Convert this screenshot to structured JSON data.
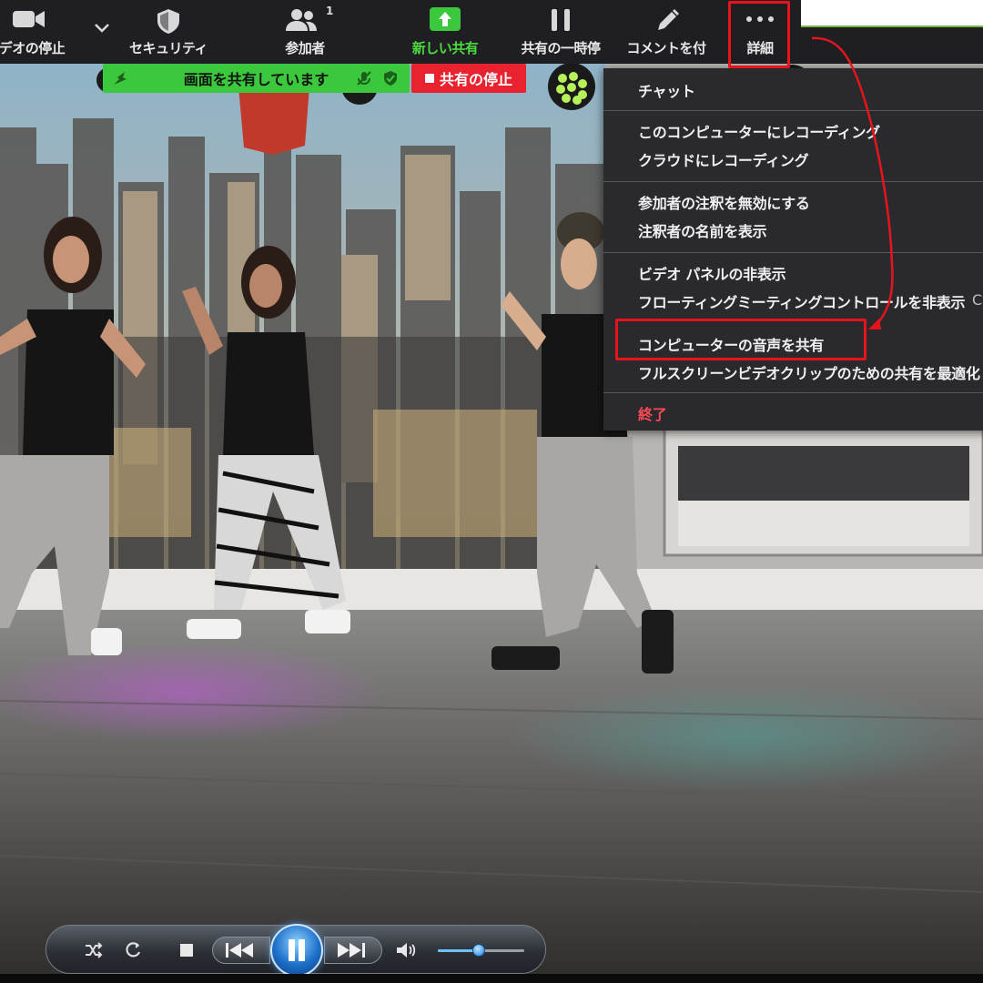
{
  "toolbar": {
    "video_label": "デオの停止",
    "security_label": "セキュリティ",
    "participants_label": "参加者",
    "participants_count": "1",
    "new_share_label": "新しい共有",
    "pause_share_label": "共有の一時停",
    "annotate_label": "コメントを付",
    "more_label": "詳細"
  },
  "share_banner": {
    "text": "画面を共有しています",
    "stop_label": "共有の停止"
  },
  "menu": {
    "chat": "チャット",
    "record_local": "このコンピューターにレコーディング",
    "record_cloud": "クラウドにレコーディング",
    "disable_annotation": "参加者の注釈を無効にする",
    "show_annotator_names": "注釈者の名前を表示",
    "hide_video_panel": "ビデオ パネルの非表示",
    "hide_floating_controls": "フローティングミーティングコントロールを非表示",
    "share_computer_audio": "コンピューターの音声を共有",
    "optimize_video_clip": "フルスクリーンビデオクリップのための共有を最適化",
    "end": "終了",
    "overflow_char": "C"
  },
  "player": {
    "volume_level": 0.47
  },
  "colors": {
    "toolbar_bg": "#1f1f23",
    "share_green": "#3cc83c",
    "stop_red": "#e8232f",
    "annotation_red": "#e8141c",
    "menu_bg": "#2a2a2e",
    "end_red": "#ff4a55"
  },
  "icons": {
    "video": "video-camera-icon",
    "security": "shield-icon",
    "participants": "people-icon",
    "new_share": "share-up-arrow-icon",
    "pause_share": "pause-icon",
    "annotate": "pencil-icon",
    "more": "ellipsis-icon"
  }
}
